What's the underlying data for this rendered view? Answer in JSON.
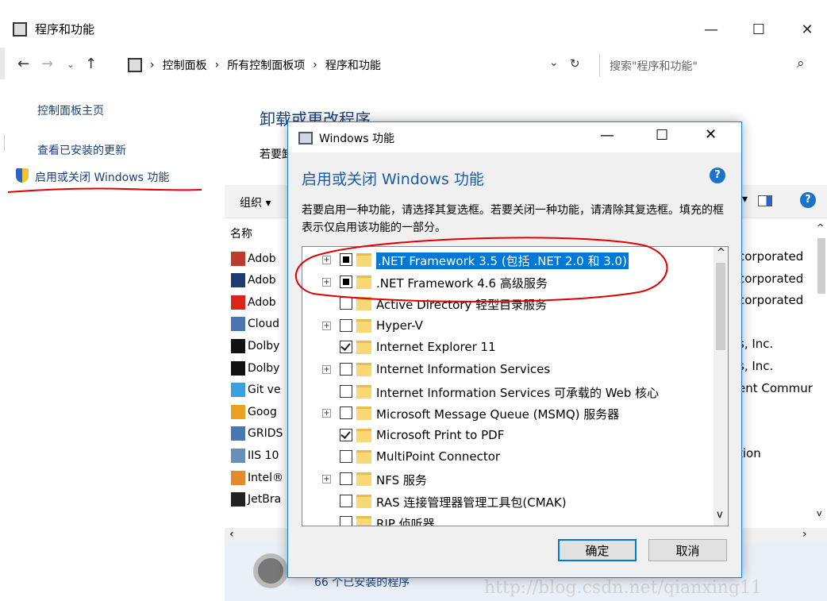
{
  "window": {
    "title": "程序和功能"
  },
  "address": {
    "path": [
      "控制面板",
      "所有控制面板项",
      "程序和功能"
    ],
    "search_placeholder": "搜索\"程序和功能\""
  },
  "sidebar": {
    "items": [
      "控制面板主页",
      "查看已安装的更新",
      "启用或关闭 Windows 功能"
    ]
  },
  "main": {
    "heading": "卸载或更改程序",
    "subtext": "若要卸",
    "organize": "组织 ▾",
    "name_column": "名称",
    "programs": [
      "Adob",
      "Adob",
      "Adob",
      "Cloud",
      "Dolby",
      "Dolby",
      "Git ve",
      "Goog",
      "GRIDS",
      "IIS 10",
      "Intel®",
      "JetBra"
    ],
    "publishers": [
      "corporated",
      "corporated",
      "corporated",
      "",
      "s, Inc.",
      "s, Inc.",
      "ent Commur",
      "",
      "",
      "tion",
      "",
      ""
    ],
    "installed_count": "66 个已安装的程序"
  },
  "dialog": {
    "title": "Windows 功能",
    "heading": "启用或关闭 Windows 功能",
    "description": "若要启用一种功能，请选择其复选框。若要关闭一种功能，请清除其复选框。填充的框表示仅启用该功能的一部分。",
    "features": [
      {
        "label": ".NET Framework 3.5 (包括 .NET 2.0 和 3.0)",
        "expandable": true,
        "state": "partial",
        "selected": true
      },
      {
        "label": ".NET Framework 4.6 高级服务",
        "expandable": true,
        "state": "partial",
        "selected": false
      },
      {
        "label": "Active Directory 轻型目录服务",
        "expandable": false,
        "state": "unchecked",
        "selected": false
      },
      {
        "label": "Hyper-V",
        "expandable": true,
        "state": "unchecked",
        "selected": false
      },
      {
        "label": "Internet Explorer 11",
        "expandable": false,
        "state": "checked",
        "selected": false
      },
      {
        "label": "Internet Information Services",
        "expandable": true,
        "state": "unchecked",
        "selected": false
      },
      {
        "label": "Internet Information Services 可承载的 Web 核心",
        "expandable": false,
        "state": "unchecked",
        "selected": false
      },
      {
        "label": "Microsoft Message Queue (MSMQ) 服务器",
        "expandable": true,
        "state": "unchecked",
        "selected": false
      },
      {
        "label": "Microsoft Print to PDF",
        "expandable": false,
        "state": "checked",
        "selected": false
      },
      {
        "label": "MultiPoint Connector",
        "expandable": false,
        "state": "unchecked",
        "selected": false
      },
      {
        "label": "NFS 服务",
        "expandable": true,
        "state": "unchecked",
        "selected": false
      },
      {
        "label": "RAS 连接管理器管理工具包(CMAK)",
        "expandable": false,
        "state": "unchecked",
        "selected": false
      },
      {
        "label": "RIP 侦听器",
        "expandable": false,
        "state": "unchecked",
        "selected": false
      }
    ],
    "ok_label": "确定",
    "cancel_label": "取消"
  },
  "watermark": "http://blog.csdn.net/qianxing11",
  "colors": {
    "accent": "#1a73c8",
    "selection": "#0078d7",
    "annotation": "#e00000"
  }
}
